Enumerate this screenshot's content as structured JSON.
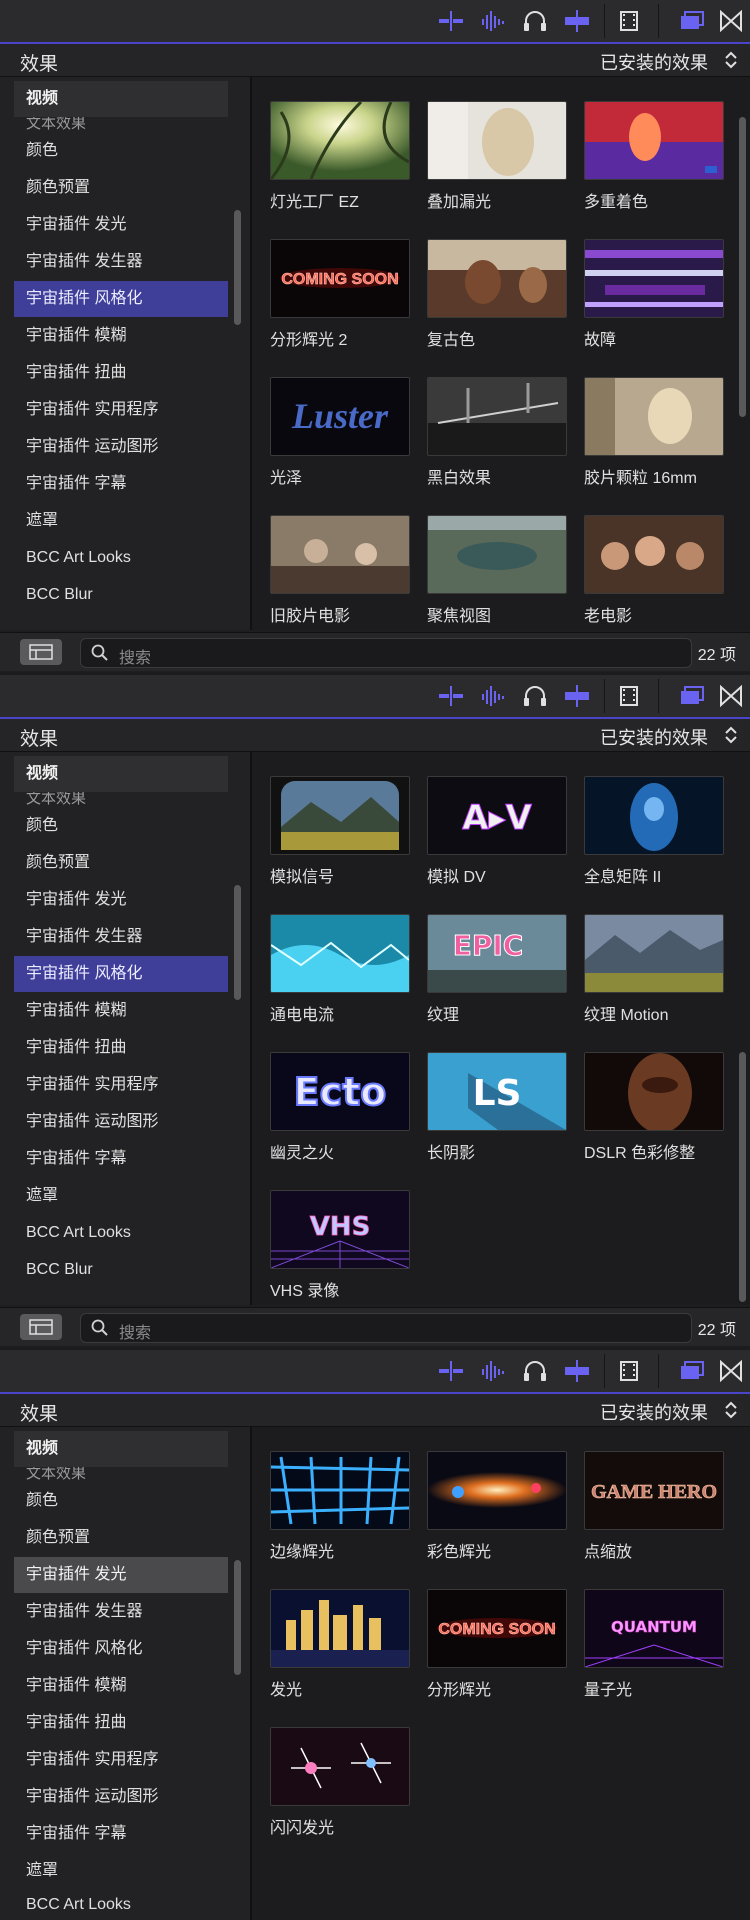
{
  "panels": [
    {
      "header": {
        "title": "效果",
        "installed": "已安装的效果"
      },
      "sidebar": [
        {
          "label": "视频"
        },
        {
          "label": "文本效果"
        },
        {
          "label": "颜色"
        },
        {
          "label": "颜色预置"
        },
        {
          "label": "宇宙插件 发光"
        },
        {
          "label": "宇宙插件 发生器"
        },
        {
          "label": "宇宙插件 风格化"
        },
        {
          "label": "宇宙插件 模糊"
        },
        {
          "label": "宇宙插件 扭曲"
        },
        {
          "label": "宇宙插件 实用程序"
        },
        {
          "label": "宇宙插件 运动图形"
        },
        {
          "label": "宇宙插件 字幕"
        },
        {
          "label": "遮罩"
        },
        {
          "label": "BCC Art Looks"
        },
        {
          "label": "BCC Blur"
        }
      ],
      "tiles": [
        {
          "label": "灯光工厂 EZ"
        },
        {
          "label": "叠加漏光"
        },
        {
          "label": "多重着色"
        },
        {
          "label": "分形辉光 2",
          "thumb_text": "COMING SOON"
        },
        {
          "label": "复古色"
        },
        {
          "label": "故障"
        },
        {
          "label": "光泽",
          "thumb_text": "Luster"
        },
        {
          "label": "黑白效果"
        },
        {
          "label": "胶片颗粒 16mm"
        },
        {
          "label": "旧胶片电影"
        },
        {
          "label": "聚焦视图"
        },
        {
          "label": "老电影"
        }
      ],
      "footer": {
        "search_placeholder": "搜索",
        "count": "22 项"
      }
    },
    {
      "header": {
        "title": "效果",
        "installed": "已安装的效果"
      },
      "sidebar": [
        {
          "label": "视频"
        },
        {
          "label": "文本效果"
        },
        {
          "label": "颜色"
        },
        {
          "label": "颜色预置"
        },
        {
          "label": "宇宙插件 发光"
        },
        {
          "label": "宇宙插件 发生器"
        },
        {
          "label": "宇宙插件 风格化"
        },
        {
          "label": "宇宙插件 模糊"
        },
        {
          "label": "宇宙插件 扭曲"
        },
        {
          "label": "宇宙插件 实用程序"
        },
        {
          "label": "宇宙插件 运动图形"
        },
        {
          "label": "宇宙插件 字幕"
        },
        {
          "label": "遮罩"
        },
        {
          "label": "BCC Art Looks"
        },
        {
          "label": "BCC Blur"
        }
      ],
      "tiles": [
        {
          "label": "模拟信号"
        },
        {
          "label": "模拟 DV",
          "thumb_text": "A▸V"
        },
        {
          "label": "全息矩阵 II"
        },
        {
          "label": "通电电流"
        },
        {
          "label": "纹理",
          "thumb_text": "EPIC"
        },
        {
          "label": "纹理 Motion"
        },
        {
          "label": "幽灵之火",
          "thumb_text": "Ecto"
        },
        {
          "label": "长阴影",
          "thumb_text": "LS"
        },
        {
          "label": "DSLR 色彩修整"
        },
        {
          "label": "VHS 录像",
          "thumb_text": "VHS"
        }
      ],
      "footer": {
        "search_placeholder": "搜索",
        "count": "22 项"
      }
    },
    {
      "header": {
        "title": "效果",
        "installed": "已安装的效果"
      },
      "sidebar": [
        {
          "label": "视频"
        },
        {
          "label": "文本效果"
        },
        {
          "label": "颜色"
        },
        {
          "label": "颜色预置"
        },
        {
          "label": "宇宙插件 发光"
        },
        {
          "label": "宇宙插件 发生器"
        },
        {
          "label": "宇宙插件 风格化"
        },
        {
          "label": "宇宙插件 模糊"
        },
        {
          "label": "宇宙插件 扭曲"
        },
        {
          "label": "宇宙插件 实用程序"
        },
        {
          "label": "宇宙插件 运动图形"
        },
        {
          "label": "宇宙插件 字幕"
        },
        {
          "label": "遮罩"
        },
        {
          "label": "BCC Art Looks"
        }
      ],
      "tiles": [
        {
          "label": "边缘辉光"
        },
        {
          "label": "彩色辉光"
        },
        {
          "label": "点缩放",
          "thumb_text": "GAME HERO"
        },
        {
          "label": "发光"
        },
        {
          "label": "分形辉光",
          "thumb_text": "COMING SOON"
        },
        {
          "label": "量子光",
          "thumb_text": "QUANTUM"
        },
        {
          "label": "闪闪发光"
        }
      ]
    }
  ],
  "colors": {
    "accent": "#4a44c8",
    "selection_blue": "#3f3f9a",
    "toolbar_icon": "#6a62f0"
  }
}
